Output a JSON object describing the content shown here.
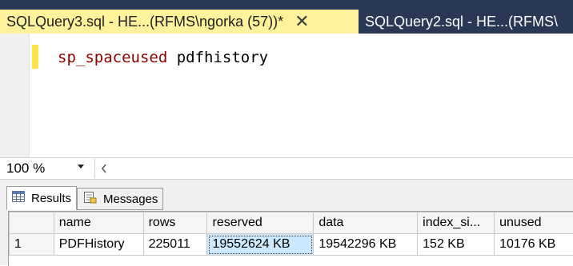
{
  "tabs": [
    {
      "label": "SQLQuery3.sql - HE...(RFMS\\ngorka (57))*",
      "active": true,
      "close_glyph": "✕"
    },
    {
      "label": "SQLQuery2.sql - HE...(RFMS\\",
      "active": false
    }
  ],
  "editor": {
    "keyword": "sp_spaceused",
    "argument": "pdfhistory"
  },
  "zoom": {
    "value": "100 %",
    "dropdown_icon": "caret-down-icon",
    "scroll_left_icon": "chevron-left-icon"
  },
  "results_tabs": [
    {
      "label": "Results",
      "icon": "grid-icon",
      "active": true
    },
    {
      "label": "Messages",
      "icon": "messages-icon",
      "active": false
    }
  ],
  "grid": {
    "columns": [
      "name",
      "rows",
      "reserved",
      "data",
      "index_si...",
      "unused"
    ],
    "rows": [
      {
        "num": "1",
        "cells": [
          "PDFHistory",
          "225011",
          "19552624 KB",
          "19542296 KB",
          "152 KB",
          "10176 KB"
        ]
      }
    ],
    "selected_cell": "reserved"
  },
  "colors": {
    "tabstrip_bg": "#293955",
    "active_tab_bg": "#fff29d",
    "keyword": "#8b0000",
    "selection": "#cce8ff"
  }
}
